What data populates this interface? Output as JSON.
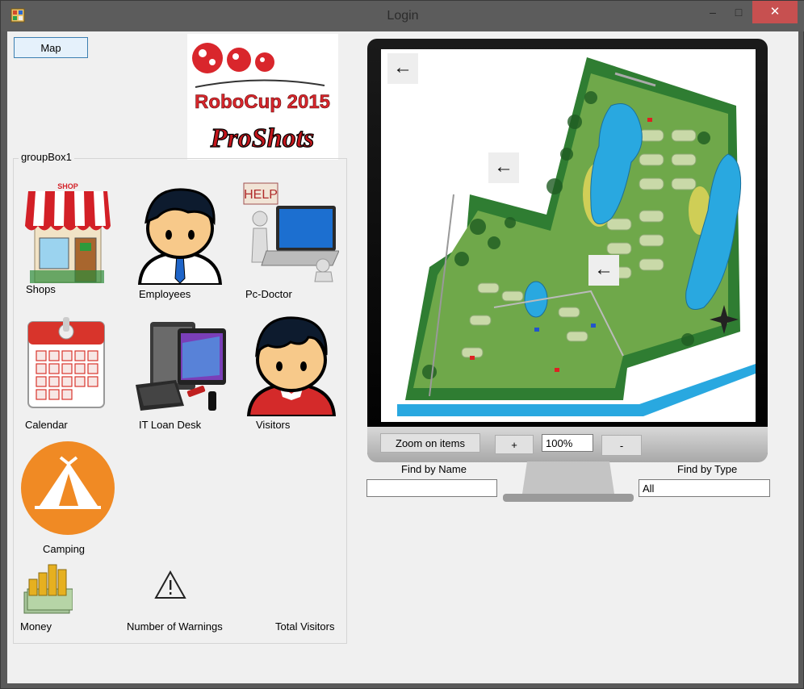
{
  "window": {
    "title": "Login",
    "minimize": "–",
    "maximize": "□",
    "close": "✕"
  },
  "toolbar": {
    "map_label": "Map"
  },
  "logo": {
    "line1": "RoboCup 2015",
    "line2": "ProShots"
  },
  "groupbox": {
    "title": "groupBox1"
  },
  "tiles": {
    "shops": "Shops",
    "employees": "Employees",
    "pc_doctor": "Pc-Doctor",
    "calendar": "Calendar",
    "it_loan": "IT Loan Desk",
    "visitors": "Visitors",
    "camping": "Camping"
  },
  "stats": {
    "money": "Money",
    "warnings": "Number of Warnings",
    "total_visitors": "Total Visitors"
  },
  "map_controls": {
    "zoom_items": "Zoom on items",
    "plus": "+",
    "zoom_value": "100%",
    "minus": "-"
  },
  "search": {
    "by_name_label": "Find by Name",
    "by_name_value": "",
    "by_type_label": "Find by Type",
    "by_type_value": "All"
  },
  "colors": {
    "close": "#c75050",
    "camping": "#f08a24",
    "map_green": "#2e7d32",
    "water": "#29a8e0"
  }
}
